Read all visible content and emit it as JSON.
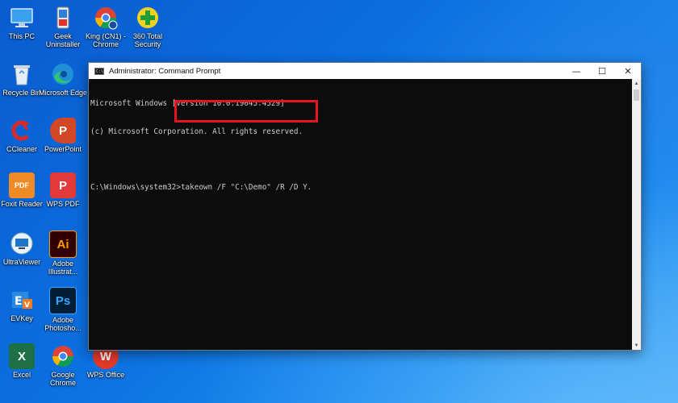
{
  "desktop": {
    "icons": [
      {
        "label": "This PC",
        "icon": "monitor-icon"
      },
      {
        "label": "Geek Uninstaller",
        "icon": "geek-uninstaller-icon"
      },
      {
        "label": "King (CN1) - Chrome",
        "icon": "chrome-icon"
      },
      {
        "label": "360 Total Security",
        "icon": "360-security-icon"
      },
      {
        "label": "Recycle Bin",
        "icon": "recycle-bin-icon"
      },
      {
        "label": "Microsoft Edge",
        "icon": "edge-icon"
      },
      {
        "label": "CCleaner",
        "icon": "ccleaner-icon"
      },
      {
        "label": "PowerPoint",
        "icon": "powerpoint-icon"
      },
      {
        "label": "Foxit Reader",
        "icon": "foxit-icon"
      },
      {
        "label": "WPS PDF",
        "icon": "wps-pdf-icon"
      },
      {
        "label": "UltraViewer",
        "icon": "ultraviewer-icon"
      },
      {
        "label": "Adobe Illustrat...",
        "icon": "illustrator-icon"
      },
      {
        "label": "EVKey",
        "icon": "evkey-icon"
      },
      {
        "label": "Adobe Photosho...",
        "icon": "photoshop-icon"
      },
      {
        "label": "Excel",
        "icon": "excel-icon"
      },
      {
        "label": "Google Chrome",
        "icon": "chrome-icon"
      },
      {
        "label": "WPS Office",
        "icon": "wps-office-icon"
      }
    ]
  },
  "window": {
    "title": "Administrator: Command Prompt",
    "icon_text": "C:\\",
    "controls": {
      "minimize": "—",
      "maximize": "☐",
      "close": "✕"
    }
  },
  "console": {
    "lines": [
      "Microsoft Windows [Version 10.0.19045.4529]",
      "(c) Microsoft Corporation. All rights reserved.",
      "",
      "C:\\Windows\\system32>takeown /F \"C:\\Demo\" /R /D Y."
    ]
  },
  "colors": {
    "highlight": "#e8141e",
    "console_bg": "#0c0c0c",
    "console_text": "#cccccc"
  }
}
